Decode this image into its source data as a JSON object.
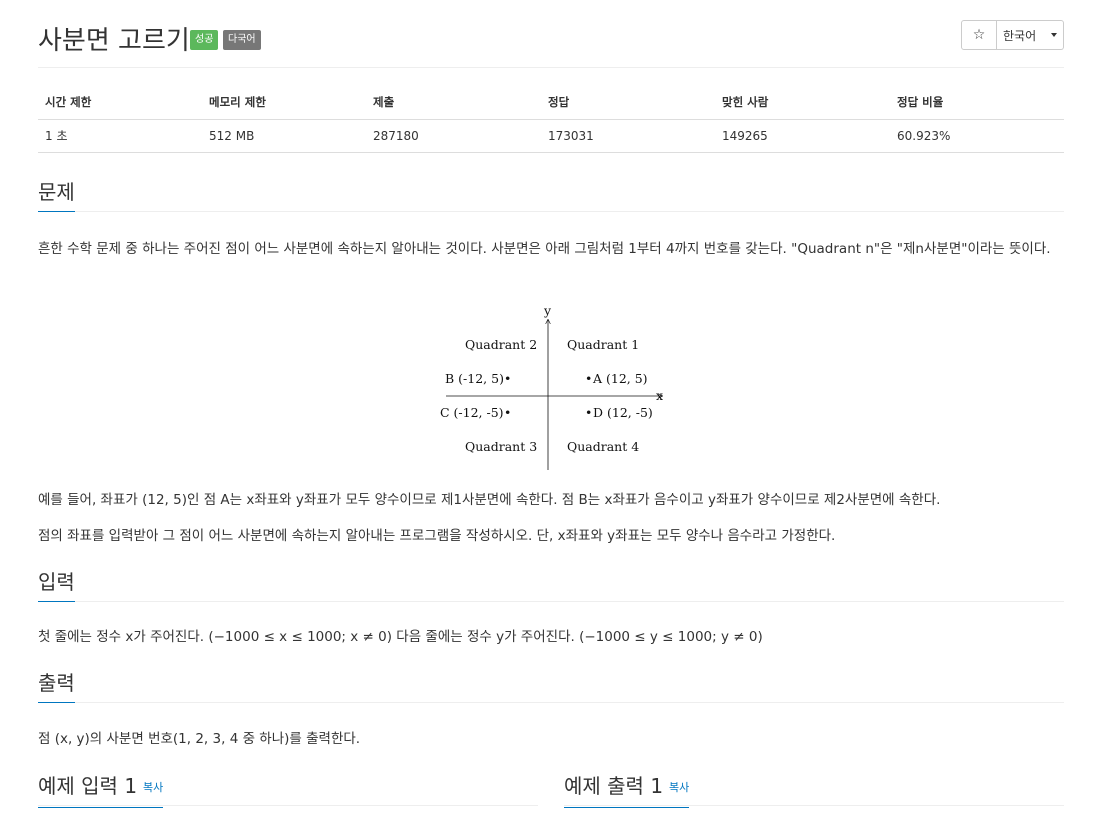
{
  "header": {
    "title": "사분면 고르기",
    "badge_success": "성공",
    "badge_multilang": "다국어",
    "star_icon": "☆",
    "language_select": "한국어"
  },
  "info_table": {
    "headers": [
      "시간 제한",
      "메모리 제한",
      "제출",
      "정답",
      "맞힌 사람",
      "정답 비율"
    ],
    "values": [
      "1 초",
      "512 MB",
      "287180",
      "173031",
      "149265",
      "60.923%"
    ]
  },
  "problem": {
    "heading": "문제",
    "intro": "흔한 수학 문제 중 하나는 주어진 점이 어느 사분면에 속하는지 알아내는 것이다. 사분면은 아래 그림처럼 1부터 4까지 번호를 갖는다. \"Quadrant n\"은 \"제n사분면\"이라는 뜻이다.",
    "example": "예를 들어, 좌표가 (12, 5)인 점 A는 x좌표와 y좌표가 모두 양수이므로 제1사분면에 속한다. 점 B는 x좌표가 음수이고 y좌표가 양수이므로 제2사분면에 속한다.",
    "task": "점의 좌표를 입력받아 그 점이 어느 사분면에 속하는지 알아내는 프로그램을 작성하시오. 단, x좌표와 y좌표는 모두 양수나 음수라고 가정한다."
  },
  "figure": {
    "y_label": "y",
    "x_label": "x",
    "q1": "Quadrant 1",
    "q2": "Quadrant 2",
    "q3": "Quadrant 3",
    "q4": "Quadrant 4",
    "pA": "A (12, 5)",
    "pB": "B (-12, 5)",
    "pC": "C (-12, -5)",
    "pD": "D (12, -5)",
    "dot": "•"
  },
  "input": {
    "heading": "입력",
    "text": "첫 줄에는 정수 x가 주어진다. (−1000 ≤ x ≤ 1000; x ≠ 0) 다음 줄에는 정수 y가 주어진다. (−1000 ≤ y ≤ 1000; y ≠ 0)"
  },
  "output": {
    "heading": "출력",
    "text": "점 (x, y)의 사분면 번호(1, 2, 3, 4 중 하나)를 출력한다."
  },
  "samples": {
    "input_heading": "예제 입력 1",
    "output_heading": "예제 출력 1",
    "copy_label": "복사"
  }
}
